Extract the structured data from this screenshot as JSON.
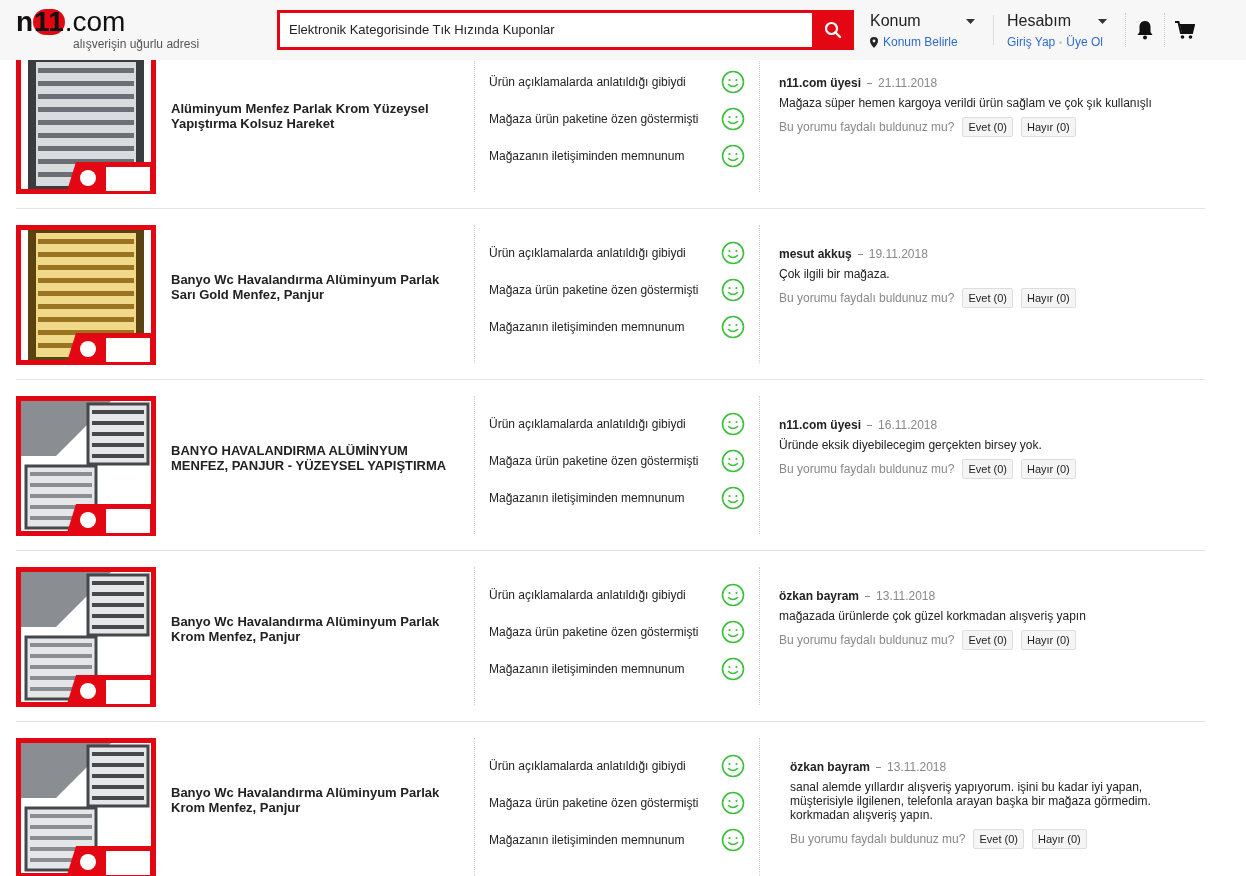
{
  "header": {
    "logo": {
      "prefix": "n",
      "middle": "11",
      "suffix": ".com"
    },
    "tagline": "alışverişin uğurlu adresi",
    "search": {
      "value": "Elektronik Kategorisinde Tık Hızında Kuponlar"
    },
    "location": {
      "title": "Konum",
      "link": "Konum Belirle"
    },
    "account": {
      "title": "Hesabım",
      "login": "Giriş Yap",
      "signup": "Üye Ol"
    }
  },
  "reviews": [
    {
      "product": "Alüminyum Menfez Parlak Krom Yüzeysel Yapıştırma Kolsuz Hareket",
      "kind": "chrome",
      "criteria": [
        "Ürün açıklamalarda anlatıldığı gibiydi",
        "Mağaza ürün paketine özen göstermişti",
        "Mağazanın iletişiminden memnunum"
      ],
      "author": "n11.com üyesi",
      "date": "21.11.2018",
      "text": "Mağaza süper hemen kargoya verildi ürün sağlam ve çok şık kullanışlı",
      "question": "Bu yorumu faydalı buldunuz mu?",
      "yes": "Evet (0)",
      "no": "Hayır (0)"
    },
    {
      "product": "Banyo Wc Havalandırma Alüminyum Parlak Sarı Gold Menfez, Panjur",
      "kind": "gold",
      "criteria": [
        "Ürün açıklamalarda anlatıldığı gibiydi",
        "Mağaza ürün paketine özen göstermişti",
        "Mağazanın iletişiminden memnunum"
      ],
      "author": "mesut akkuş",
      "date": "19.11.2018",
      "text": "Çok ilgili bir mağaza.",
      "question": "Bu yorumu faydalı buldunuz mu?",
      "yes": "Evet (0)",
      "no": "Hayır (0)"
    },
    {
      "product": "BANYO HAVALANDIRMA ALÜMİNYUM MENFEZ, PANJUR - YÜZEYSEL YAPIŞTIRMA",
      "kind": "set",
      "criteria": [
        "Ürün açıklamalarda anlatıldığı gibiydi",
        "Mağaza ürün paketine özen göstermişti",
        "Mağazanın iletişiminden memnunum"
      ],
      "author": "n11.com üyesi",
      "date": "16.11.2018",
      "text": "Üründe eksik diyebilecegim gerçekten birsey yok.",
      "question": "Bu yorumu faydalı buldunuz mu?",
      "yes": "Evet (0)",
      "no": "Hayır (0)"
    },
    {
      "product": "Banyo Wc Havalandırma Alüminyum Parlak Krom Menfez, Panjur",
      "kind": "set",
      "criteria": [
        "Ürün açıklamalarda anlatıldığı gibiydi",
        "Mağaza ürün paketine özen göstermişti",
        "Mağazanın iletişiminden memnunum"
      ],
      "author": "özkan bayram",
      "date": "13.11.2018",
      "text": "mağazada ürünlerde çok güzel korkmadan alışveriş yapın",
      "question": "Bu yorumu faydalı buldunuz mu?",
      "yes": "Evet (0)",
      "no": "Hayır (0)"
    },
    {
      "product": "Banyo Wc Havalandırma Alüminyum Parlak Krom Menfez, Panjur",
      "kind": "set",
      "criteria": [
        "Ürün açıklamalarda anlatıldığı gibiydi",
        "Mağaza ürün paketine özen göstermişti",
        "Mağazanın iletişiminden memnunum"
      ],
      "author": "özkan bayram",
      "date": "13.11.2018",
      "text": "sanal alemde yıllardır alışveriş yapıyorum. işini bu kadar iyi yapan, müşterisiyle ilgilenen, telefonla arayan başka bir mağaza görmedim. korkmadan alışveriş yapın.",
      "question": "Bu yorumu faydalı buldunuz mu?",
      "yes": "Evet (0)",
      "no": "Hayır (0)"
    }
  ]
}
